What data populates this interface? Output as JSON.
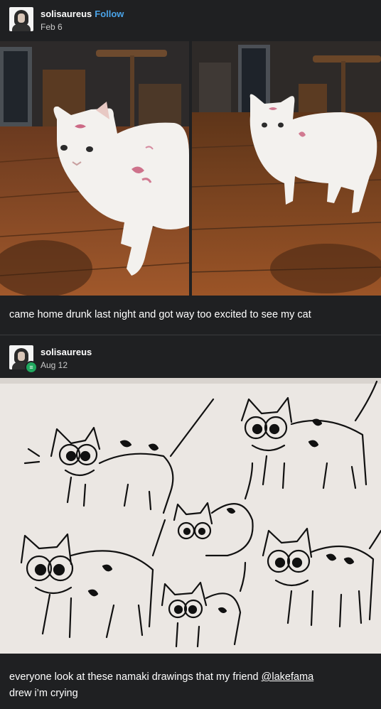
{
  "post1": {
    "username": "solisaureus",
    "follow_label": "Follow",
    "date": "Feb 6",
    "caption": "came home drunk last night and got way too excited to see my cat"
  },
  "post2": {
    "username": "solisaureus",
    "date": "Aug 12",
    "caption_before": "everyone look at these namaki drawings that my friend ",
    "mention": "@lakefama",
    "caption_after": "drew i’m crying"
  },
  "icons": {
    "badge": "green-badge-icon"
  },
  "colors": {
    "background": "#1f2022",
    "follow": "#4aa3e8",
    "badge": "#1fa85e"
  }
}
